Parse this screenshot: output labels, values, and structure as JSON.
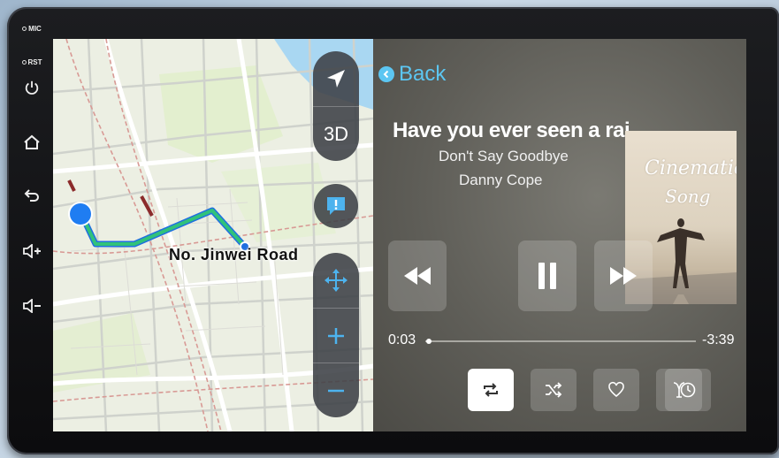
{
  "device": {
    "buttons": [
      {
        "label": "MIC",
        "icon": "mic-hole-icon"
      },
      {
        "label": "RST",
        "icon": "reset-hole-icon"
      },
      {
        "label": "",
        "icon": "power-icon"
      },
      {
        "label": "",
        "icon": "home-icon"
      },
      {
        "label": "",
        "icon": "back-icon"
      },
      {
        "label": "",
        "icon": "volume-up-icon"
      },
      {
        "label": "",
        "icon": "volume-down-icon"
      }
    ]
  },
  "map": {
    "road_label": "No.  Jinwei Road",
    "controls": {
      "view_3d_label": "3D",
      "compass_icon": "navigation-arrow-icon",
      "alert_icon": "report-alert-icon",
      "pan_icon": "pan-arrows-icon",
      "zoom_in_icon": "plus-icon",
      "zoom_out_icon": "minus-icon"
    },
    "route_color": "#31c27a",
    "current_location_color": "#1f7df2"
  },
  "music": {
    "back_label": "Back",
    "song_title": "Have you ever seen a rai...",
    "album": "Don't Say Goodbye",
    "artist": "Danny Cope",
    "album_art": {
      "title_line1": "Cinematic",
      "title_line2": "Song"
    },
    "elapsed": "0:03",
    "remaining": "-3:39",
    "progress_fraction": 0.014,
    "transport": [
      "rewind-icon",
      "pause-icon",
      "fast-forward-icon"
    ],
    "bottom_controls": [
      {
        "icon": "repeat-icon",
        "active": true
      },
      {
        "icon": "shuffle-icon",
        "active": false
      },
      {
        "icon": "heart-icon",
        "active": false
      },
      {
        "icon": "genius-icon",
        "active": false
      },
      {
        "icon": "clock-icon",
        "active": false
      }
    ],
    "accent_color": "#5cc6f2"
  }
}
